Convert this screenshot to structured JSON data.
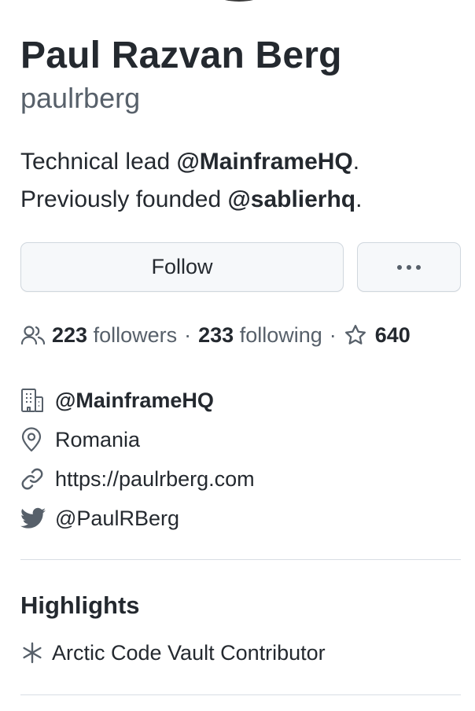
{
  "profile": {
    "name": "Paul Razvan Berg",
    "login": "paulrberg",
    "bio": {
      "line1_text": "Technical lead ",
      "line1_mention": "@MainframeHQ",
      "line1_end": ".",
      "line2_text": "Previously founded ",
      "line2_mention": "@sablierhq",
      "line2_end": "."
    }
  },
  "actions": {
    "follow_label": "Follow",
    "more_icon": "kebab-horizontal-icon"
  },
  "stats": {
    "people_icon": "people-icon",
    "followers_count": "223",
    "followers_label": "followers",
    "separator": "·",
    "following_count": "233",
    "following_label": "following",
    "star_icon": "star-icon",
    "stars_count": "640"
  },
  "details": {
    "organization": {
      "icon": "organization-icon",
      "text": "@MainframeHQ"
    },
    "location": {
      "icon": "location-icon",
      "text": "Romania"
    },
    "website": {
      "icon": "link-icon",
      "text": "https://paulrberg.com"
    },
    "twitter": {
      "icon": "twitter-icon",
      "text": "@PaulRBerg"
    }
  },
  "highlights": {
    "heading": "Highlights",
    "items": [
      {
        "icon": "snowflake-icon",
        "text": "Arctic Code Vault Contributor"
      }
    ]
  },
  "colors": {
    "text_primary": "#24292f",
    "text_muted": "#57606a",
    "border": "#d0d7de",
    "button_bg": "#f6f8fa"
  }
}
